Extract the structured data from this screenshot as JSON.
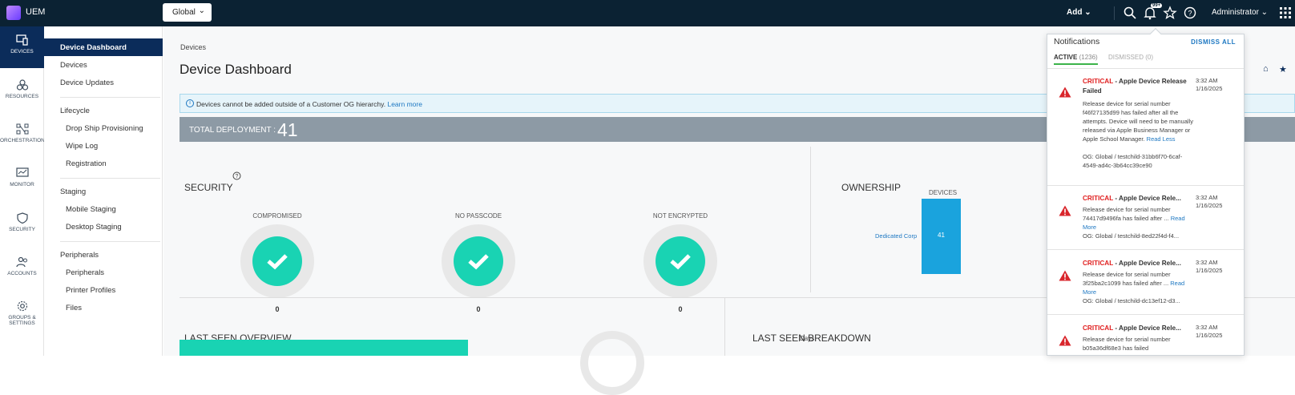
{
  "app": {
    "name": "UEM"
  },
  "header": {
    "og_select": "Global",
    "add_label": "Add",
    "notification_count": "99+",
    "user": "Administrator"
  },
  "rail": [
    {
      "label": "DEVICES",
      "icon": "devices-icon",
      "active": true
    },
    {
      "label": "RESOURCES",
      "icon": "resources-icon"
    },
    {
      "label": "ORCHESTRATION",
      "icon": "orchestration-icon"
    },
    {
      "label": "MONITOR",
      "icon": "monitor-icon"
    },
    {
      "label": "SECURITY",
      "icon": "shield-icon"
    },
    {
      "label": "ACCOUNTS",
      "icon": "accounts-icon"
    },
    {
      "label": "GROUPS & SETTINGS",
      "icon": "gear-icon"
    }
  ],
  "subnav": {
    "device_dashboard": "Device Dashboard",
    "devices": "Devices",
    "device_updates": "Device Updates",
    "lifecycle": "Lifecycle",
    "drop_ship": "Drop Ship Provisioning",
    "wipe_log": "Wipe Log",
    "registration": "Registration",
    "staging": "Staging",
    "mobile_staging": "Mobile Staging",
    "desktop_staging": "Desktop Staging",
    "peripherals": "Peripherals",
    "peripherals_item": "Peripherals",
    "printer_profiles": "Printer Profiles",
    "files": "Files"
  },
  "main": {
    "breadcrumb": "Devices",
    "title": "Device Dashboard",
    "info_text": "Devices cannot be added outside of a Customer OG hierarchy.",
    "info_link": "Learn more",
    "total_label": "TOTAL DEPLOYMENT :",
    "total_value": "41",
    "security": {
      "title": "SECURITY",
      "gauges": [
        {
          "label": "COMPROMISED",
          "value": "0"
        },
        {
          "label": "NO PASSCODE",
          "value": "0"
        },
        {
          "label": "NOT ENCRYPTED",
          "value": "0"
        }
      ]
    },
    "ownership": {
      "title": "OWNERSHIP",
      "axis": "DEVICES",
      "label": "Dedicated Corp",
      "value": "41"
    },
    "last_seen_overview": "LAST SEEN OVERVIEW",
    "last_seen_breakdown": "LAST SEEN BREAKDOWN",
    "days": "Days"
  },
  "notifications": {
    "title": "Notifications",
    "dismiss_all": "DISMISS ALL",
    "tab_active": "ACTIVE",
    "tab_active_count": "(1236)",
    "tab_dismissed": "DISMISSED (0)",
    "items": [
      {
        "severity": "CRITICAL",
        "title_rest": " - Apple Device Release Failed",
        "time": "3:32 AM",
        "date": "1/16/2025",
        "body": "Release device for serial number f46f27135d99 has failed after all the attempts. Device will need to be manually released via Apple Business Manager or Apple School Manager.",
        "link": "Read Less",
        "og": "OG: Global / testchild-31bb6f70-6caf-4549-ad4c-3b64cc39ce90"
      },
      {
        "severity": "CRITICAL",
        "title_rest": " - Apple Device Rele...",
        "time": "3:32 AM",
        "date": "1/16/2025",
        "body": "Release device for serial number 74417d9496fa has failed after ...",
        "link": "Read More",
        "og": "OG: Global / testchild-8ed22f4d-f4..."
      },
      {
        "severity": "CRITICAL",
        "title_rest": " - Apple Device Rele...",
        "time": "3:32 AM",
        "date": "1/16/2025",
        "body": "Release device for serial number 3f25ba2c1099 has failed after ...",
        "link": "Read More",
        "og": "OG: Global / testchild-dc13ef12-d3..."
      },
      {
        "severity": "CRITICAL",
        "title_rest": " - Apple Device Rele...",
        "time": "3:32 AM",
        "date": "1/16/2025",
        "body": "Release device for serial number b05a36df68e3 has failed",
        "link": "",
        "og": ""
      }
    ]
  }
}
